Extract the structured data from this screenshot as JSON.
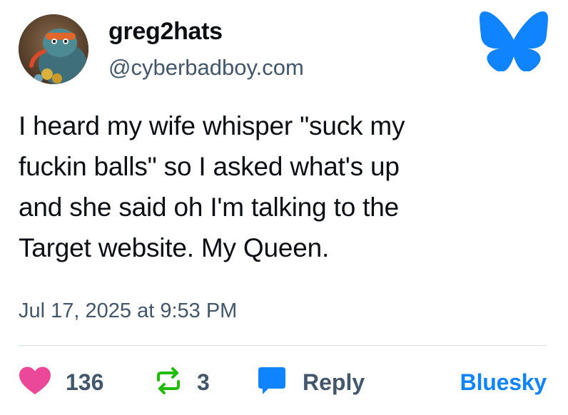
{
  "author": {
    "display_name": "greg2hats",
    "handle": "@cyberbadboy.com",
    "avatar_icon": "avatar-image"
  },
  "logo": {
    "icon": "bluesky-butterfly-icon",
    "color": "#1083fe"
  },
  "post": {
    "text": "I heard my wife whisper \"suck my\nfuckin balls\" so I asked what's up\nand she said oh I'm talking to the\nTarget website. My Queen.",
    "timestamp": "Jul 17, 2025 at 9:53 PM"
  },
  "actions": {
    "like_count": "136",
    "like_icon": "heart-icon",
    "like_color": "#ec4899",
    "repost_count": "3",
    "repost_icon": "repost-icon",
    "repost_color": "#20bc07",
    "reply_label": "Reply",
    "reply_icon": "speech-bubble-icon",
    "reply_color": "#1083fe",
    "link_label": "Bluesky"
  },
  "colors": {
    "text_primary": "#0b0f14",
    "text_secondary": "#42576c",
    "accent": "#1083fe",
    "divider": "#dbe1e8"
  }
}
